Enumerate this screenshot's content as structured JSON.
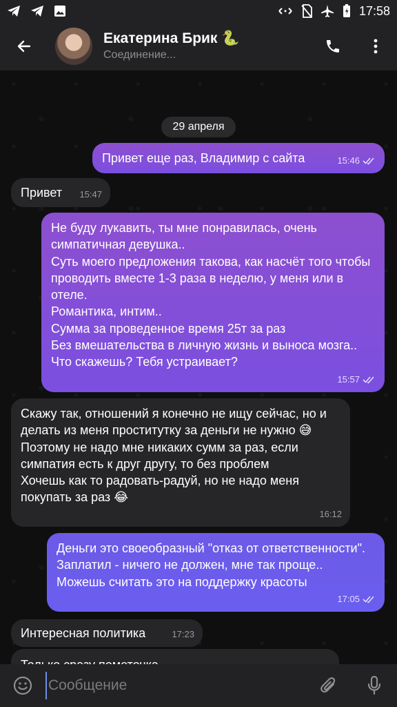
{
  "status_bar": {
    "time": "17:58",
    "left_icons": [
      "telegram-icon",
      "telegram-icon",
      "image-icon"
    ],
    "right_icons": [
      "data-saver-icon",
      "no-sim-icon",
      "airplane-icon",
      "battery-icon"
    ]
  },
  "header": {
    "name": "Екатерина Брик 🐍",
    "status": "Соединение..."
  },
  "chat": {
    "date": "29 апреля",
    "messages": [
      {
        "dir": "out",
        "text": "Привет еще раз, Владимир с сайта",
        "time": "15:46",
        "read": true
      },
      {
        "dir": "in",
        "text": "Привет",
        "time": "15:47"
      },
      {
        "dir": "out",
        "text": "Не буду лукавить, ты мне понравилась, очень симпатичная девушка..\nСуть моего предложения такова, как насчёт того чтобы проводить вместе 1-3 раза в неделю, у меня или в отеле.\nРомантика, интим..\nСумма за проведенное время 25т за раз\nБез вмешательства в личную жизнь и выноса мозга..\nЧто скажешь? Тебя устраивает?",
        "time": "15:57",
        "read": true
      },
      {
        "dir": "in",
        "text": "Скажу так, отношений я конечно не ищу сейчас, но и делать из меня проститутку за деньги не нужно 😅\nПоэтому не надо мне никаких сумм за раз, если симпатия есть к друг другу, то без проблем\nХочешь как то радовать-радуй, но не надо меня покупать за раз 😂",
        "time": "16:12"
      },
      {
        "dir": "out",
        "text": "Деньги это своеобразный \"отказ от ответственности\". Заплатил - ничего не должен, мне так проще.. Можешь считать это на поддержку красоты",
        "time": "17:05",
        "read": true
      },
      {
        "dir": "in",
        "text": "Интересная политика",
        "time": "17:23"
      },
      {
        "dir": "in",
        "text": "Только сразу пометочка",
        "time": ""
      }
    ]
  },
  "input": {
    "placeholder": "Сообщение"
  },
  "colors": {
    "accent": "#6d8fe8",
    "outgoing_top": "#8d4fcf",
    "outgoing_bottom": "#6a5ef0",
    "incoming": "#262628",
    "header": "#222224"
  }
}
